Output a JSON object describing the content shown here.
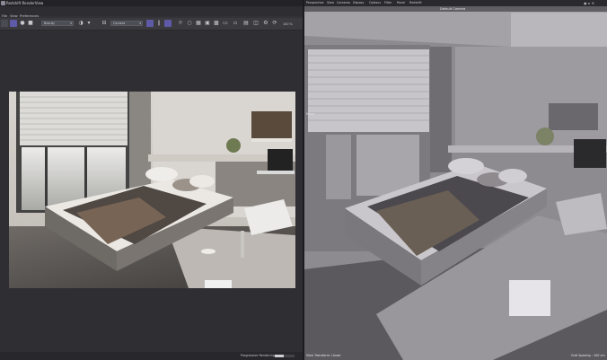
{
  "render_window": {
    "title": "Redshift RenderView",
    "menu": [
      "File",
      "View",
      "Preferences"
    ],
    "toolbar": {
      "render_mode": "Beauty",
      "camera": "Camera",
      "zoom": "100 %"
    },
    "status": {
      "progress_label": "Progressive Rendering",
      "progress": 0.45
    }
  },
  "viewport": {
    "menu": [
      "Perspective",
      "View",
      "Cameras",
      "Display",
      "Options",
      "Filter",
      "Panel",
      "Redshift"
    ],
    "camera_label": "Default Camera",
    "window_controls": "◉ ▫ ✕",
    "side_label": "Move",
    "status_left": "View Transform: Linear",
    "status_right": "Grid Spacing : 100 cm"
  },
  "icons": {
    "app": "app-logo-icon",
    "render": "render-icon",
    "snapshot": "snapshot-icon",
    "crop": "crop-icon",
    "settings": "gear-icon"
  },
  "colors": {
    "accent": "#5f5aa8",
    "panel": "#333236",
    "viewport": "#8b898f"
  }
}
